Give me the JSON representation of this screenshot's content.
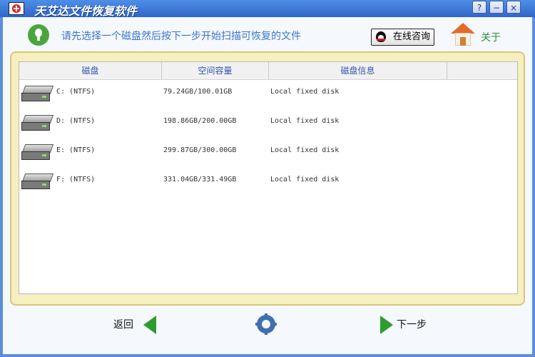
{
  "window": {
    "title": "天艾达文件恢复软件",
    "controls": [
      "?",
      "−",
      "×"
    ]
  },
  "header": {
    "instruction": "请先选择一个磁盘然后按下一步开始扫描可恢复的文件",
    "consult_label": "在线咨询",
    "about_label": "关于"
  },
  "table": {
    "columns": [
      "磁盘",
      "空间容量",
      "磁盘信息"
    ],
    "rows": [
      {
        "drive": "C:  (NTFS)",
        "capacity": "79.24GB/100.01GB",
        "info": "Local fixed disk"
      },
      {
        "drive": "D:  (NTFS)",
        "capacity": "198.86GB/200.00GB",
        "info": "Local fixed disk"
      },
      {
        "drive": "E:  (NTFS)",
        "capacity": "299.87GB/300.00GB",
        "info": "Local fixed disk"
      },
      {
        "drive": "F:  (NTFS)",
        "capacity": "331.04GB/331.49GB",
        "info": "Local fixed disk"
      }
    ]
  },
  "footer": {
    "back_label": "返回",
    "next_label": "下一步"
  }
}
